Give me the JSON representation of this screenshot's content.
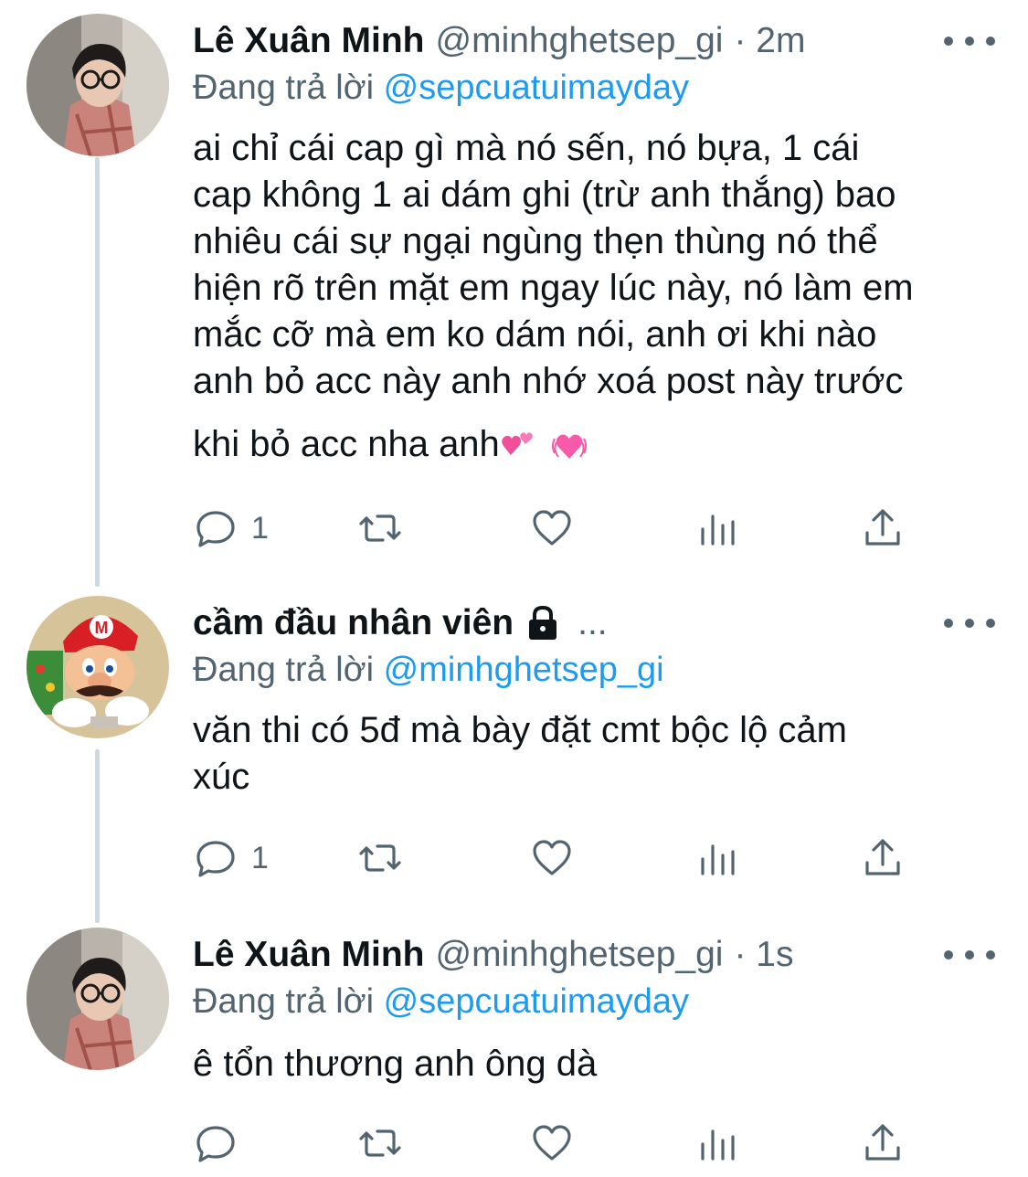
{
  "thread": [
    {
      "name": "Lê Xuân Minh",
      "handle": "@minhghetsep_gi",
      "time": "· 2m",
      "replying_label": "Đang trả lời",
      "replying_to": "@sepcuatuimayday",
      "text_lines": [
        "ai chỉ cái cap gì mà nó sến, nó bựa, 1 cái",
        "cap không 1 ai dám ghi (trừ anh thắng) bao",
        "nhiêu cái sự ngại ngùng thẹn thùng nó thể",
        "hiện rõ trên mặt em ngay lúc này, nó làm em",
        "mắc cỡ mà em ko dám nói, anh ơi khi nào",
        "anh bỏ acc này anh nhớ xoá post này trước",
        "khi bỏ acc nha anh"
      ],
      "emoji": [
        "two-hearts",
        "growing-heart"
      ],
      "reply_count": "1",
      "avatar_icon": "person-with-glasses-avatar"
    },
    {
      "name": "cầm đầu nhân viên",
      "handle": "",
      "time": "...",
      "protected_icon": "lock-icon",
      "replying_label": "Đang trả lời",
      "replying_to": "@minhghetsep_gi",
      "text_lines": [
        "văn thi có 5đ mà bày đặt cmt bộc lộ cảm",
        "xúc"
      ],
      "reply_count": "1",
      "avatar_icon": "mario-avatar"
    },
    {
      "name": "Lê Xuân Minh",
      "handle": "@minhghetsep_gi",
      "time": "· 1s",
      "replying_label": "Đang trả lời",
      "replying_to": "@sepcuatuimayday",
      "text_lines": [
        "ê tổn thương anh ông dà"
      ],
      "reply_count": "",
      "avatar_icon": "person-with-glasses-avatar"
    }
  ],
  "colors": {
    "text": "#0f1419",
    "secondary": "#536471",
    "link": "#1d9bf0",
    "thread_line": "#cfd9de"
  },
  "action_icons": [
    "reply-icon",
    "retweet-icon",
    "like-icon",
    "analytics-icon",
    "share-icon"
  ]
}
